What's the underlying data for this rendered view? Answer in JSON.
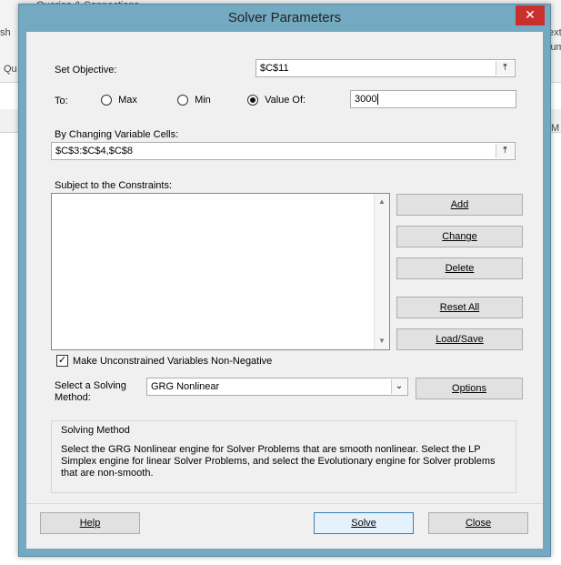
{
  "background": {
    "ribbon_text": "Queries & Connections",
    "ribbon_left_text": "Qu",
    "ribbon_left_text2": "sh",
    "ribbon_right_text1": "ext",
    "ribbon_right_text2": "lum",
    "col_header_right": "M"
  },
  "dialog": {
    "title": "Solver Parameters",
    "close_glyph": "✕",
    "set_objective_label": "Set Objective:",
    "set_objective_value": "$C$11",
    "to_label": "To:",
    "max_label": "Max",
    "min_label": "Min",
    "value_of_label": "Value Of:",
    "value_of_value": "3000",
    "changing_cells_label": "By Changing Variable Cells:",
    "changing_cells_value": "$C$3:$C$4,$C$8",
    "constraints_label": "Subject to the Constraints:",
    "buttons": {
      "add": "Add",
      "change": "Change",
      "delete": "Delete",
      "reset_all": "Reset All",
      "load_save": "Load/Save",
      "options": "Options",
      "help": "Help",
      "solve": "Solve",
      "close": "Close"
    },
    "nonneg_label": "Make Unconstrained Variables Non-Negative",
    "nonneg_checked": true,
    "select_method_label_1": "Select a Solving",
    "select_method_label_2": "Method:",
    "method_value": "GRG Nonlinear",
    "solving_method_title": "Solving Method",
    "solving_method_text": "Select the GRG Nonlinear engine for Solver Problems that are smooth nonlinear. Select the LP Simplex engine for linear Solver Problems, and select the Evolutionary engine for Solver problems that are non-smooth."
  }
}
